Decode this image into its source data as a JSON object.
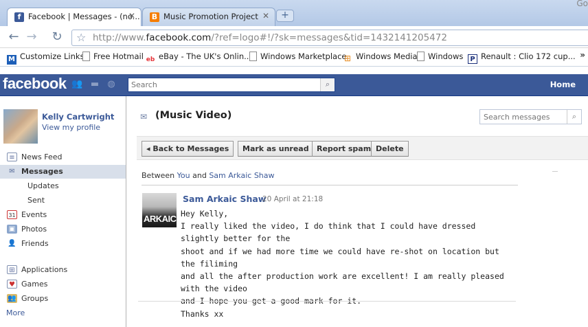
{
  "browser": {
    "tabs": [
      {
        "title": "Facebook | Messages - (no...",
        "active": true,
        "favicon": "facebook-icon",
        "favicon_color": "#3b5998"
      },
      {
        "title": "Music Promotion Project",
        "active": false,
        "favicon": "blogger-icon",
        "favicon_color": "#f57d00"
      }
    ],
    "corner_text": "Go",
    "url_prefix": "http://www.",
    "url_host": "facebook.com",
    "url_rest": "/?ref=logo#!/?sk=messages&tid=1432141205472",
    "bookmarks": [
      {
        "label": "Customize Links",
        "icon": "msn-icon"
      },
      {
        "label": "Free Hotmail",
        "icon": "page-icon"
      },
      {
        "label": "eBay - The UK's Onlin...",
        "icon": "ebay-icon"
      },
      {
        "label": "Windows Marketplace",
        "icon": "page-icon"
      },
      {
        "label": "Windows Media",
        "icon": "windows-icon"
      },
      {
        "label": "Windows",
        "icon": "page-icon"
      },
      {
        "label": "Renault : Clio 172 cup...",
        "icon": "parking-icon"
      }
    ],
    "bookmarks_overflow": "»"
  },
  "fb": {
    "logo": "facebook",
    "search_placeholder": "Search",
    "home_label": "Home",
    "brand_color": "#3b5998"
  },
  "sidebar": {
    "profile_name": "Kelly Cartwright",
    "profile_link": "View my profile",
    "nav": [
      {
        "label": "News Feed",
        "icon": "news-feed-icon",
        "active": false
      },
      {
        "label": "Messages",
        "icon": "messages-icon",
        "active": true
      }
    ],
    "message_subitems": [
      "Updates",
      "Sent"
    ],
    "nav2": [
      {
        "label": "Events",
        "icon": "calendar-icon",
        "badge": "31"
      },
      {
        "label": "Photos",
        "icon": "photos-icon"
      },
      {
        "label": "Friends",
        "icon": "friends-icon"
      }
    ],
    "nav3": [
      {
        "label": "Applications",
        "icon": "applications-icon"
      },
      {
        "label": "Games",
        "icon": "games-icon"
      },
      {
        "label": "Groups",
        "icon": "groups-icon"
      }
    ],
    "more_label": "More"
  },
  "thread": {
    "title": "(Music Video)",
    "search_placeholder": "Search messages",
    "actions": {
      "back": "Back to Messages",
      "mark_unread": "Mark as unread",
      "report_spam": "Report spam",
      "delete": "Delete"
    },
    "between_prefix": "Between",
    "between_you": "You",
    "between_and": "and",
    "between_other": "Sam Arkaic Shaw"
  },
  "message": {
    "sender": "Sam Arkaic Shaw",
    "timestamp": "20 April at 21:18",
    "sender_pic_text": "ARKAIC",
    "lines": [
      "Hey Kelly,",
      "I really liked the video, I do think that I could have dressed slightly better for the",
      "shoot and if we had more time we could have re-shot on location but the filiming",
      "and all the after production work are excellent! I am really pleased with the video",
      "and I hope you get a good mark for it.",
      "Thanks xx"
    ]
  }
}
